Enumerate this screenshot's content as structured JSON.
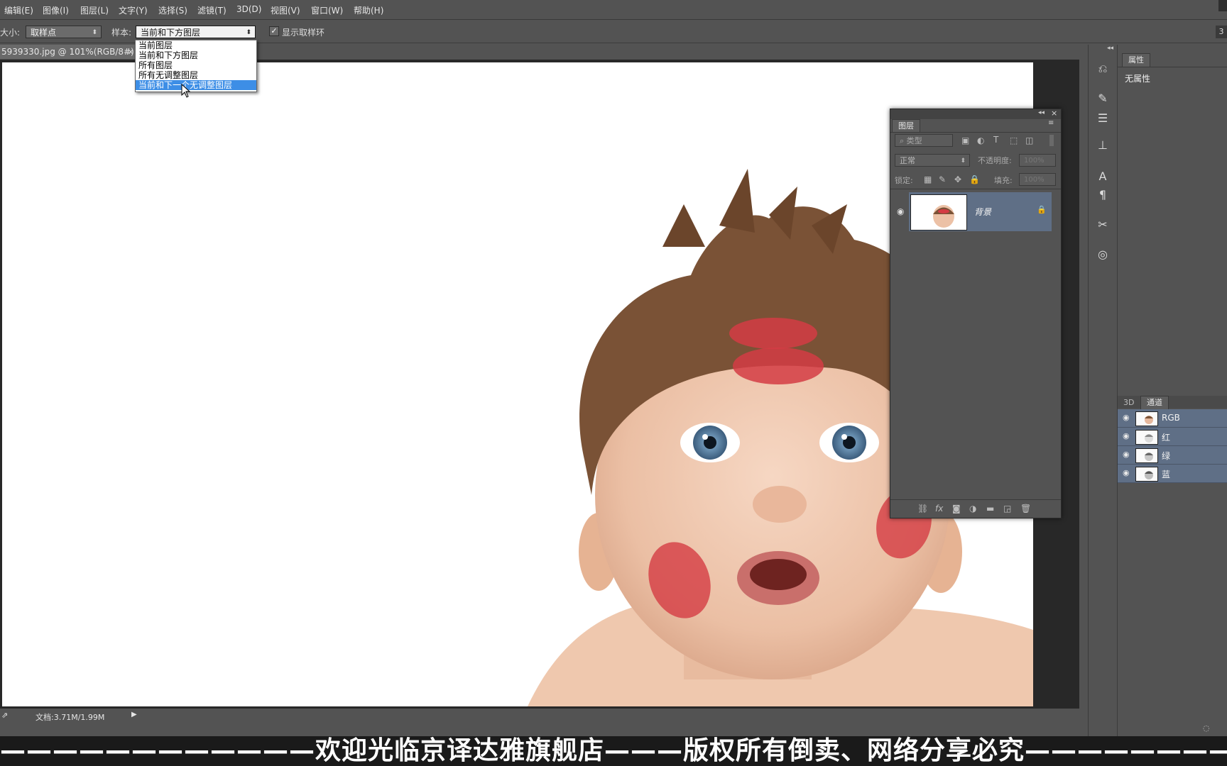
{
  "menu": [
    "编辑(E)",
    "图像(I)",
    "图层(L)",
    "文字(Y)",
    "选择(S)",
    "滤镜(T)",
    "3D(D)",
    "视图(V)",
    "窗口(W)",
    "帮助(H)"
  ],
  "options": {
    "size_label": "大小:",
    "size_value": "取样点",
    "sample_label": "样本:",
    "sample_value": "当前和下方图层",
    "show_ring_label": "显示取样环",
    "right_num": "3"
  },
  "dropdown": {
    "items": [
      "当前图层",
      "当前和下方图层",
      "所有图层",
      "所有无调整图层",
      "当前和下一个无调整图层"
    ],
    "highlighted_index": 4
  },
  "doc_tab": {
    "title": "5939330.jpg @ 101%(RGB/8#)",
    "close": "×"
  },
  "status": {
    "doc_size": "文档:3.71M/1.99M"
  },
  "properties": {
    "tab": "属性",
    "empty_text": "无属性"
  },
  "channels": {
    "tab_3d": "3D",
    "tab_channels": "通道",
    "rows": [
      "RGB",
      "红",
      "绿",
      "蓝"
    ]
  },
  "layers": {
    "tab": "图层",
    "filter_label": "类型",
    "blend_mode": "正常",
    "opacity_label": "不透明度:",
    "opacity_value": "100%",
    "lock_label": "锁定:",
    "fill_label": "填充:",
    "fill_value": "100%",
    "layer_name": "背景"
  },
  "subtitle": "————————————欢迎光临京译达雅旗舰店———版权所有倒卖、网络分享必究————————————",
  "colors": {
    "panel": "#535353",
    "selection": "#5f6f86",
    "highlight": "#3d8ee6"
  }
}
